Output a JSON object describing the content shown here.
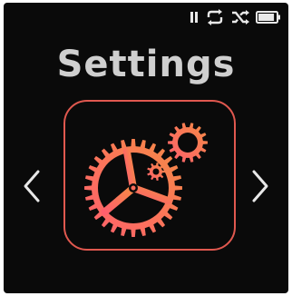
{
  "screen": {
    "title": "Settings",
    "status": {
      "icons": [
        "pause-icon",
        "repeat-icon",
        "shuffle-icon",
        "battery-icon"
      ],
      "battery_level": 0.9
    },
    "menu_item": {
      "icon": "gears-icon"
    },
    "nav": {
      "prev_icon": "chevron-left-icon",
      "next_icon": "chevron-right-icon"
    },
    "colors": {
      "background": "#0a0a0a",
      "title": "#cfcfcf",
      "accent_outline": "#e0584f",
      "gear_gradient_start": "#ff5f6d",
      "gear_gradient_end": "#f58b45",
      "icons": "#e8e8e8"
    }
  }
}
